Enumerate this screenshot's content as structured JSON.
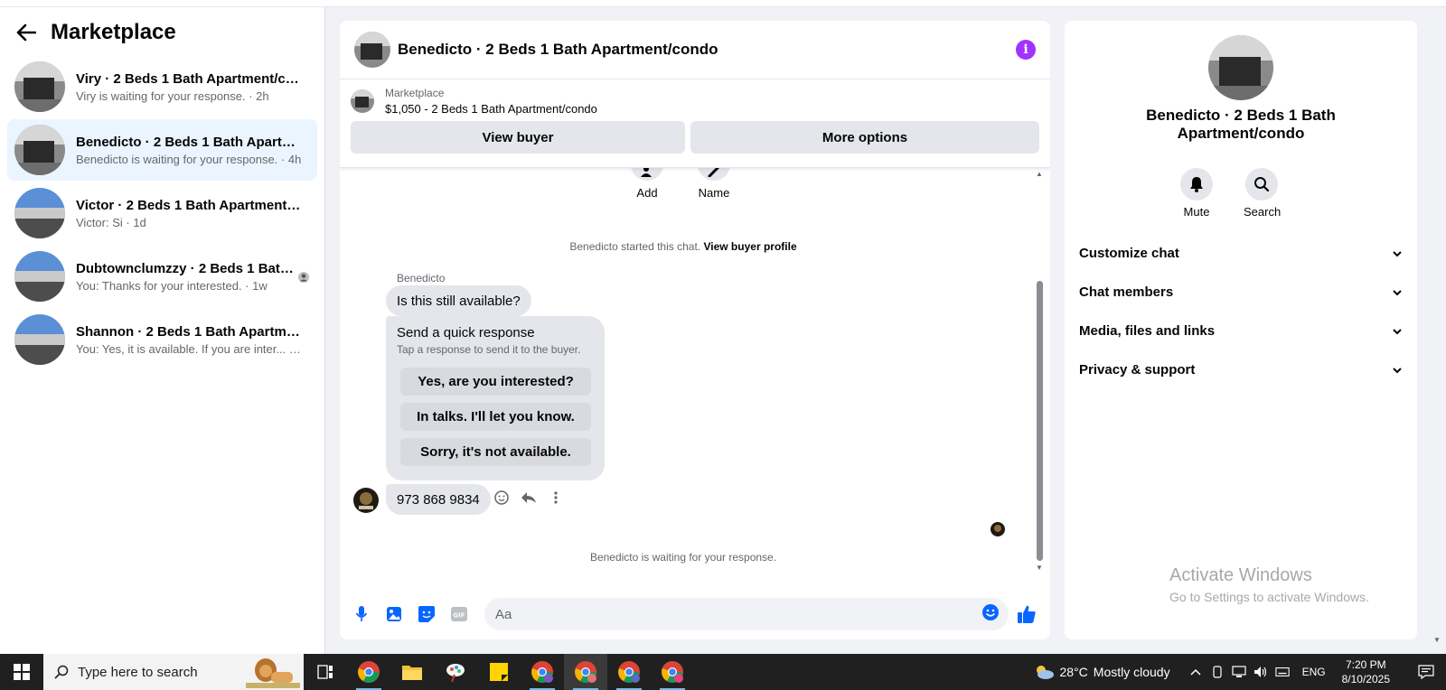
{
  "sidebar": {
    "title": "Marketplace",
    "conversations": [
      {
        "name": "Viry · 2 Beds 1 Bath Apartment/condo",
        "sub": "Viry is waiting for your response. · 2h"
      },
      {
        "name": "Benedicto · 2 Beds 1 Bath Apartment/condo",
        "sub": "Benedicto is waiting for your response. · 4h"
      },
      {
        "name": "Victor · 2 Beds 1 Bath Apartment/condo",
        "sub": "Victor: Si · 1d"
      },
      {
        "name": "Dubtownclumzzy · 2 Beds 1 Bath Apartment/condo",
        "sub": "You: Thanks for your interested. · 1w"
      },
      {
        "name": "Shannon · 2 Beds 1 Bath Apartment/condo",
        "sub": "You: Yes, it is available. If you are inter... · 1w"
      }
    ]
  },
  "chat": {
    "title": "Benedicto · 2 Beds 1 Bath Apartment/condo",
    "listing_label": "Marketplace",
    "listing_price": "$1,050 - 2 Beds 1 Bath Apartment/condo",
    "view_buyer": "View buyer",
    "more_options": "More options",
    "add_label": "Add",
    "name_label": "Name",
    "started_text": "Benedicto started this chat.",
    "view_profile": "View buyer profile",
    "sender": "Benedicto",
    "msg1": "Is this still available?",
    "quick_title": "Send a quick response",
    "quick_sub": "Tap a response to send it to the buyer.",
    "quick_options": [
      "Yes, are you interested?",
      "In talks. I'll let you know.",
      "Sorry, it's not available."
    ],
    "msg2": "973 868 9834",
    "waiting": "Benedicto is waiting for your response.",
    "input_placeholder": "Aa"
  },
  "details": {
    "name": "Benedicto · 2 Beds 1 Bath Apartment/condo",
    "mute": "Mute",
    "search": "Search",
    "menu": [
      "Customize chat",
      "Chat members",
      "Media, files and links",
      "Privacy & support"
    ],
    "activate_title": "Activate Windows",
    "activate_sub": "Go to Settings to activate Windows."
  },
  "taskbar": {
    "search_placeholder": "Type here to search",
    "temperature": "28°C",
    "weather": "Mostly cloudy",
    "lang": "ENG",
    "time": "7:20 PM",
    "date": "8/10/2025"
  },
  "colors": {
    "accent": "#0866ff",
    "info": "#a033ff",
    "active_row": "#ebf5ff"
  }
}
